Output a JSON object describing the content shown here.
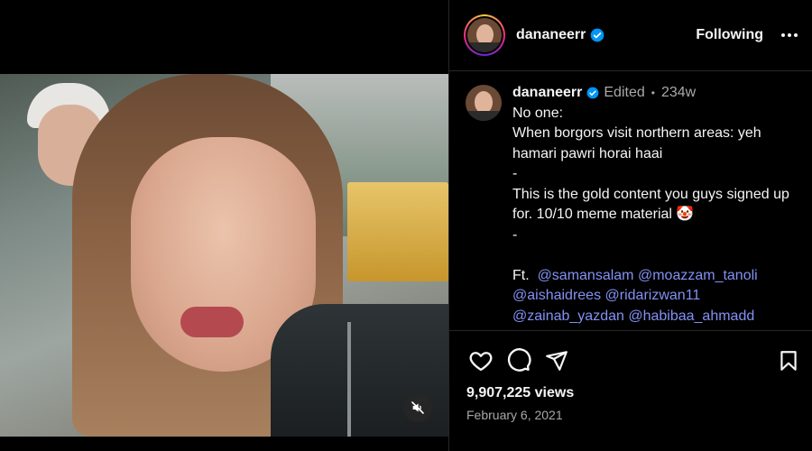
{
  "post": {
    "username": "dananeerr",
    "follow_label": "Following",
    "caption": {
      "edited_label": "Edited",
      "age": "234w",
      "lines": [
        "No one:",
        "When borgors visit northern areas: yeh hamari pawri horai haai",
        "-",
        "This is the gold content you guys signed up for. 10/10 meme material 🤡",
        "-",
        ""
      ],
      "ft_label": "Ft.",
      "mentions": [
        "@samansalam",
        "@moazzam_tanoli",
        "@aishaidrees",
        "@ridarizwan11",
        "@zainab_yazdan",
        "@habibaa_ahmadd"
      ]
    },
    "views": "9,907,225 views",
    "date": "February 6, 2021"
  },
  "colors": {
    "background": "#000000",
    "text": "#f5f5f5",
    "muted": "#a8a8a8",
    "mention": "#8391f4",
    "verified": "#0095f6"
  },
  "icons": [
    "verified-badge-icon",
    "more-options-icon",
    "heart-icon",
    "comment-icon",
    "share-icon",
    "bookmark-icon",
    "mute-icon"
  ]
}
